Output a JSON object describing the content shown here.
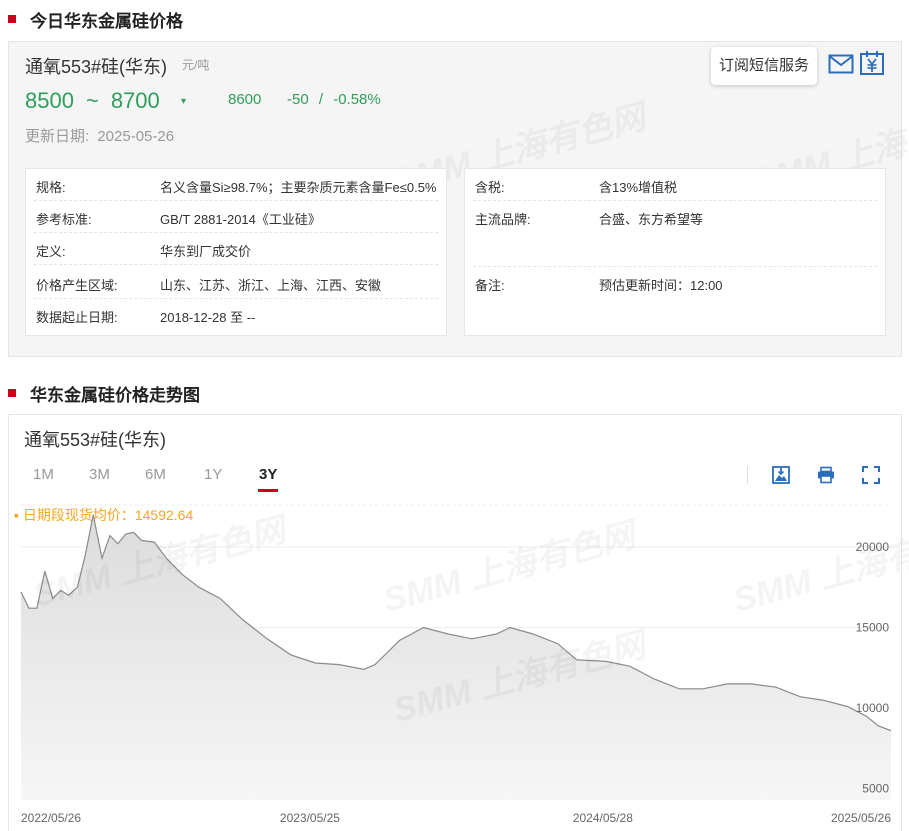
{
  "section1": {
    "title": "今日华东金属硅价格"
  },
  "product": {
    "name": "通氧553#硅(华东)",
    "unit": "元/吨",
    "price_low": "8500",
    "tilde": "~",
    "price_high": "8700",
    "trend_glyph": "▾",
    "avg": "8600",
    "change": "-50",
    "change_sep": "/",
    "change_pct": "-0.58%",
    "update_label": "更新日期:",
    "update_date": "2025-05-26"
  },
  "subscribe": {
    "label": "订阅短信服务"
  },
  "watermark": "SMM 上海有色网",
  "specs_left": [
    {
      "k": "规格:",
      "v": "名义含量Si≥98.7%；主要杂质元素含量Fe≤0.5%"
    },
    {
      "k": "参考标准:",
      "v": "GB/T 2881-2014《工业硅》"
    },
    {
      "k": "定义:",
      "v": "华东到厂成交价"
    },
    {
      "k": "价格产生区域:",
      "v": "山东、江苏、浙江、上海、江西、安徽"
    },
    {
      "k": "数据起止日期:",
      "v": "2018-12-28 至 --"
    }
  ],
  "specs_right": [
    {
      "k": "含税:",
      "v": "含13%增值税"
    },
    {
      "k": "主流品牌:",
      "v": "合盛、东方希望等"
    },
    {
      "k": "备注:",
      "v": "预估更新时间：12:00"
    }
  ],
  "section2": {
    "title": "华东金属硅价格走势图"
  },
  "chart_panel": {
    "name": "通氧553#硅(华东)",
    "tabs": [
      "1M",
      "3M",
      "6M",
      "1Y",
      "3Y"
    ],
    "active_tab": "3Y",
    "avg_label": "▪ 日期段现货均价：",
    "avg_value": "14592.64"
  },
  "chart_data": {
    "type": "area",
    "title": "",
    "xlabel": "",
    "ylabel": "",
    "x_ticks": [
      "2022/05/26",
      "2023/05/25",
      "2024/05/28",
      "2025/05/26"
    ],
    "y_ticks": [
      5000,
      10000,
      15000,
      20000
    ],
    "ylim": [
      4300,
      22600
    ],
    "grid": true,
    "series": [
      {
        "values": [
          [
            "2022-05-26",
            17200
          ],
          [
            "2022-06-05",
            16200
          ],
          [
            "2022-06-15",
            16200
          ],
          [
            "2022-06-25",
            18500
          ],
          [
            "2022-07-05",
            16800
          ],
          [
            "2022-07-15",
            17300
          ],
          [
            "2022-07-25",
            17000
          ],
          [
            "2022-08-05",
            17500
          ],
          [
            "2022-08-15",
            19500
          ],
          [
            "2022-08-25",
            22000
          ],
          [
            "2022-09-05",
            19300
          ],
          [
            "2022-09-15",
            20700
          ],
          [
            "2022-09-25",
            20200
          ],
          [
            "2022-10-05",
            20800
          ],
          [
            "2022-10-15",
            20900
          ],
          [
            "2022-10-25",
            20400
          ],
          [
            "2022-11-10",
            20300
          ],
          [
            "2022-11-25",
            19300
          ],
          [
            "2022-12-15",
            18300
          ],
          [
            "2023-01-05",
            17500
          ],
          [
            "2023-02-01",
            16800
          ],
          [
            "2023-03-01",
            15500
          ],
          [
            "2023-04-01",
            14300
          ],
          [
            "2023-05-01",
            13300
          ],
          [
            "2023-06-01",
            12800
          ],
          [
            "2023-07-01",
            12700
          ],
          [
            "2023-08-01",
            12400
          ],
          [
            "2023-08-15",
            12700
          ],
          [
            "2023-09-15",
            14200
          ],
          [
            "2023-10-15",
            15000
          ],
          [
            "2023-11-15",
            14600
          ],
          [
            "2023-12-15",
            14300
          ],
          [
            "2024-01-15",
            14600
          ],
          [
            "2024-02-01",
            15000
          ],
          [
            "2024-03-01",
            14600
          ],
          [
            "2024-04-01",
            14000
          ],
          [
            "2024-04-25",
            13000
          ],
          [
            "2024-06-01",
            12900
          ],
          [
            "2024-07-01",
            12600
          ],
          [
            "2024-08-01",
            11800
          ],
          [
            "2024-09-01",
            11200
          ],
          [
            "2024-10-01",
            11200
          ],
          [
            "2024-11-01",
            11500
          ],
          [
            "2024-12-01",
            11500
          ],
          [
            "2025-01-01",
            11300
          ],
          [
            "2025-02-01",
            10700
          ],
          [
            "2025-03-01",
            10500
          ],
          [
            "2025-04-01",
            10100
          ],
          [
            "2025-04-25",
            9500
          ],
          [
            "2025-05-10",
            8900
          ],
          [
            "2025-05-26",
            8600
          ]
        ]
      }
    ],
    "legend": "top-left",
    "colors": {
      "line": "#8a8a8a",
      "fill": "#e8e8e8",
      "grid": "#eeeeee"
    }
  }
}
